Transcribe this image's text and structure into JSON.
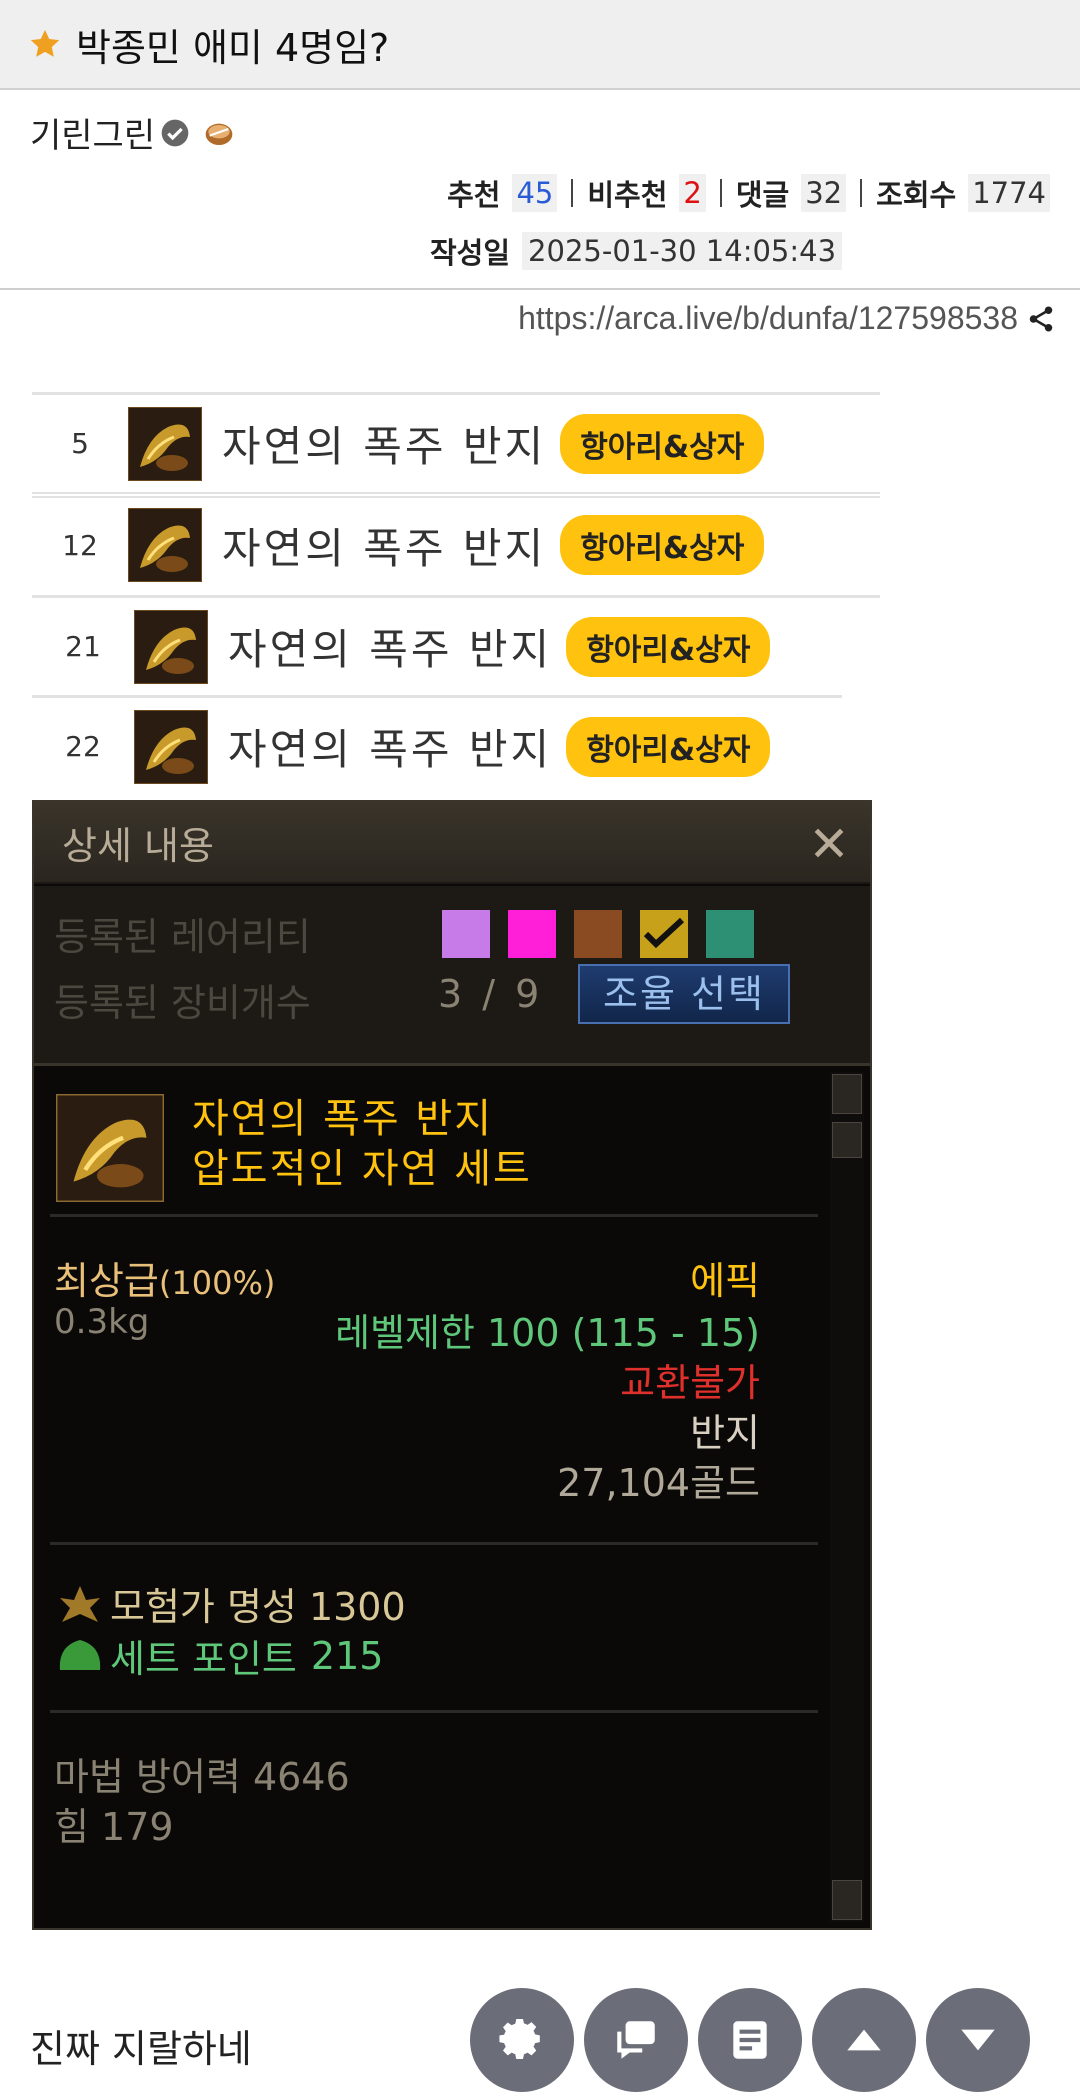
{
  "post": {
    "title": "박종민 애미 4명임?",
    "author": "기린그린",
    "stats": {
      "recommend_label": "추천",
      "recommend": "45",
      "notrecommend_label": "비추천",
      "notrecommend": "2",
      "comments_label": "댓글",
      "comments": "32",
      "views_label": "조회수",
      "views": "1774"
    },
    "date_label": "작성일",
    "date": "2025-01-30 14:05:43",
    "url": "https://arca.live/b/dunfa/127598538"
  },
  "items": [
    {
      "num": "5",
      "name": "자연의 폭주 반지",
      "tag": "항아리&상자"
    },
    {
      "num": "12",
      "name": "자연의 폭주 반지",
      "tag": "항아리&상자"
    },
    {
      "num": "21",
      "name": "자연의 폭주 반지",
      "tag": "항아리&상자"
    },
    {
      "num": "22",
      "name": "자연의 폭주 반지",
      "tag": "항아리&상자"
    }
  ],
  "tooltip": {
    "header": "상세 내용",
    "rarity_label": "등록된 레어리티",
    "rarity_colors": [
      "#c77be8",
      "#ff1fd8",
      "#8a4a22",
      "#c7a11a",
      "#2d8f73"
    ],
    "count_label": "등록된 장비개수",
    "count": "3 / 9",
    "select_button": "조율 선택",
    "item_name": "자연의 폭주 반지",
    "set_name": "압도적인 자연 세트",
    "grade": "최상급",
    "grade_pct": "(100%)",
    "rarity": "에픽",
    "weight": "0.3kg",
    "level": "레벨제한 100 (115 - 15)",
    "trade": "교환불가",
    "type": "반지",
    "price": "27,104골드",
    "fame": "모험가 명성 1300",
    "set_point_label": "세트 포인트",
    "set_point": "215",
    "magic_def": "마법 방어력 4646",
    "str": "힘 179"
  },
  "comment": "진짜 지랄하네",
  "fabs": [
    "gear-icon",
    "comment-icon",
    "list-icon",
    "arrow-up-icon",
    "arrow-down-icon"
  ]
}
